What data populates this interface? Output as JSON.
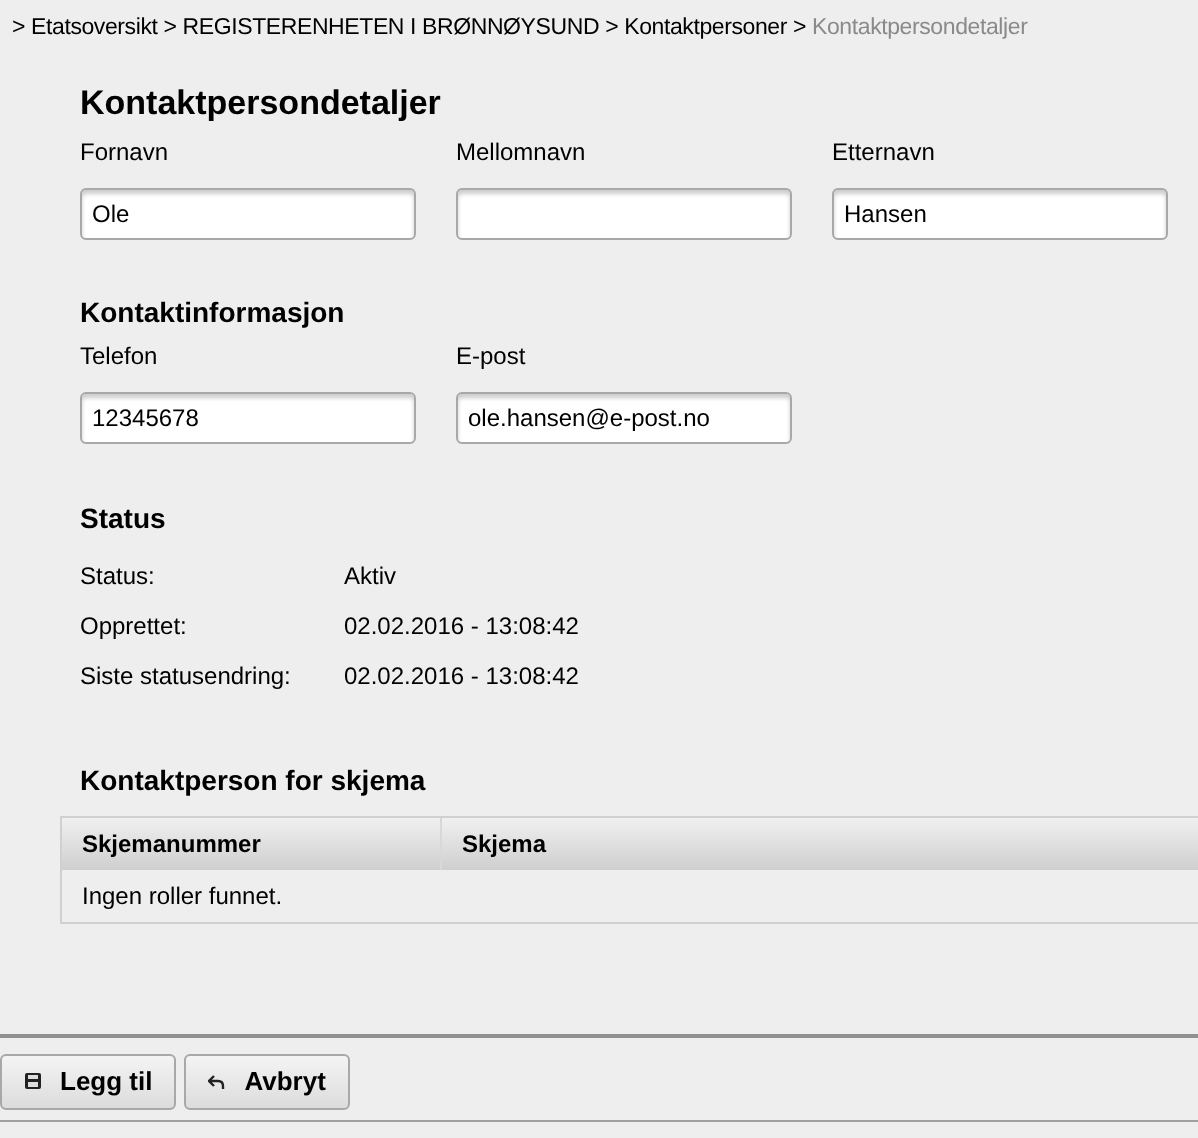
{
  "breadcrumb": [
    {
      "label": "Etatsoversikt",
      "current": false
    },
    {
      "label": "REGISTERENHETEN I BRØNNØYSUND",
      "current": false
    },
    {
      "label": "Kontaktpersoner",
      "current": false
    },
    {
      "label": "Kontaktpersondetaljer",
      "current": true
    }
  ],
  "separator": ">",
  "title": "Kontaktpersondetaljer",
  "name_fields": [
    {
      "label": "Fornavn",
      "value": "Ole"
    },
    {
      "label": "Mellomnavn"
    },
    {
      "label": "Etternavn",
      "value": "Hansen"
    }
  ],
  "contact_section": {
    "title": "Kontaktinformasjon",
    "fields": [
      {
        "label": "Telefon",
        "value": "12345678"
      },
      {
        "label": "E-post",
        "value": "ole.hansen@e-post.no"
      }
    ]
  },
  "status_section": {
    "title": "Status",
    "rows": [
      {
        "label": "Status:",
        "value": "Aktiv"
      },
      {
        "label": "Opprettet:",
        "value": "02.02.2016 - 13:08:42"
      },
      {
        "label": "Siste statusendring:",
        "value": "02.02.2016 - 13:08:42"
      }
    ]
  },
  "forms_section": {
    "title": "Kontaktperson for skjema",
    "table": {
      "columns": [
        "Skjemanummer",
        "Skjema"
      ],
      "empty_text": "Ingen roller funnet."
    }
  },
  "buttons": [
    {
      "label": "Legg til",
      "kind": "save"
    },
    {
      "label": "Avbryt",
      "kind": "cancel"
    }
  ]
}
